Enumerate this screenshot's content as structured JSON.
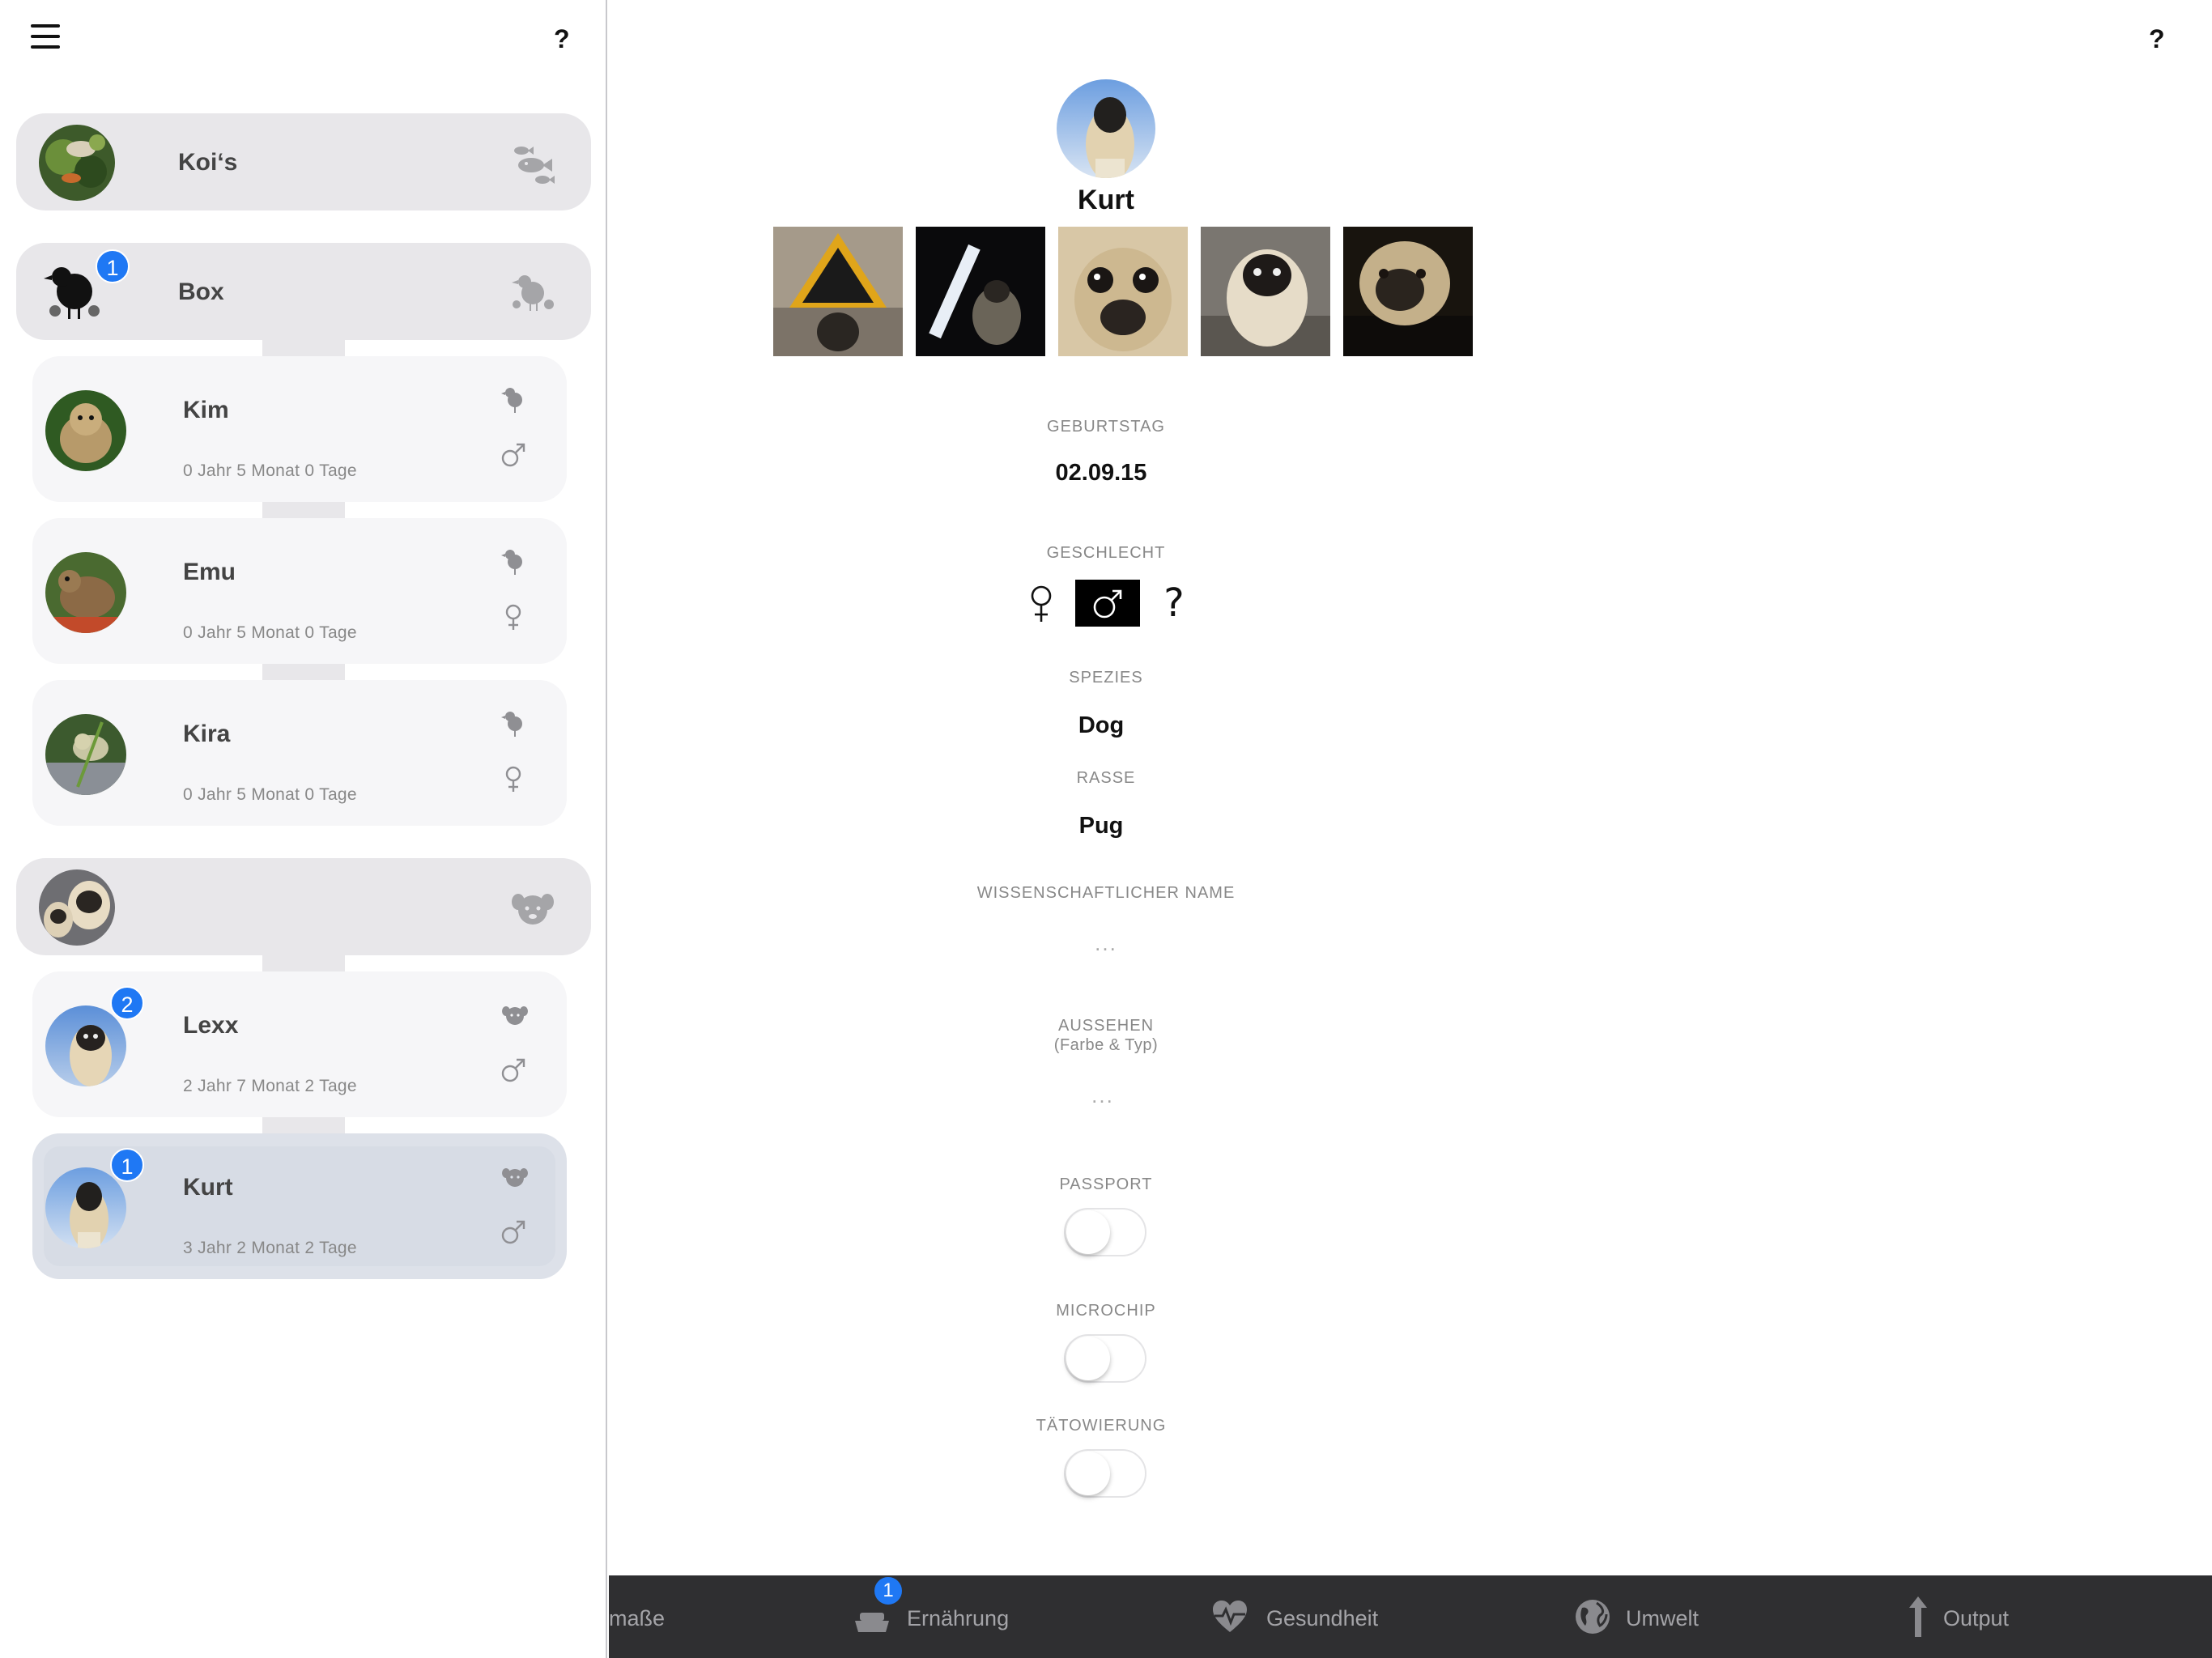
{
  "sidebar": {
    "help_label": "?",
    "groups": [
      {
        "name": "Koi‘s"
      },
      {
        "name": "Box",
        "badge": "1"
      },
      {
        "name": ""
      }
    ],
    "animals": [
      {
        "name": "Kim",
        "age": "0 Jahr 5 Monat 0 Tage",
        "sex": "male"
      },
      {
        "name": "Emu",
        "age": "0 Jahr 5 Monat 0 Tage",
        "sex": "female"
      },
      {
        "name": "Kira",
        "age": "0 Jahr 5 Monat 0 Tage",
        "sex": "female"
      },
      {
        "name": "Lexx",
        "age": "2 Jahr 7 Monat 2 Tage",
        "sex": "male",
        "badge": "2"
      },
      {
        "name": "Kurt",
        "age": "3 Jahr 2 Monat 2 Tage",
        "sex": "male",
        "badge": "1",
        "selected": true
      }
    ]
  },
  "detail": {
    "help_label": "?",
    "name": "Kurt",
    "birthday_label": "GEBURTSTAG",
    "birthday_value": "02.09.15",
    "sex_label": "GESCHLECHT",
    "sex_options": [
      "female",
      "male",
      "unknown"
    ],
    "sex_selected": "male",
    "sex_unknown_glyph": "?",
    "species_label": "SPEZIES",
    "species_value": "Dog",
    "breed_label": "RASSE",
    "breed_value": "Pug",
    "sci_name_label": "WISSENSCHAFTLICHER NAME",
    "sci_name_value": "...",
    "look_label": "AUSSEHEN",
    "look_sublabel": "(Farbe & Typ)",
    "look_value": "...",
    "passport_label": "PASSPORT",
    "passport_on": false,
    "microchip_label": "MICROCHIP",
    "microchip_on": false,
    "tattoo_label": "TÄTOWIERUNG",
    "tattoo_on": false
  },
  "tabbar": {
    "tabs": [
      {
        "label": "maße",
        "icon": "measure-icon"
      },
      {
        "label": "Ernährung",
        "icon": "bowl-icon",
        "badge": "1"
      },
      {
        "label": "Gesundheit",
        "icon": "heart-pulse-icon"
      },
      {
        "label": "Umwelt",
        "icon": "globe-icon"
      },
      {
        "label": "Output",
        "icon": "arrow-up-icon"
      }
    ]
  },
  "colors": {
    "badge": "#1f78f4",
    "tabbar_bg": "#2f2f31",
    "group_bg": "#e8e7ea",
    "selected_bg": "#dde1e9"
  }
}
